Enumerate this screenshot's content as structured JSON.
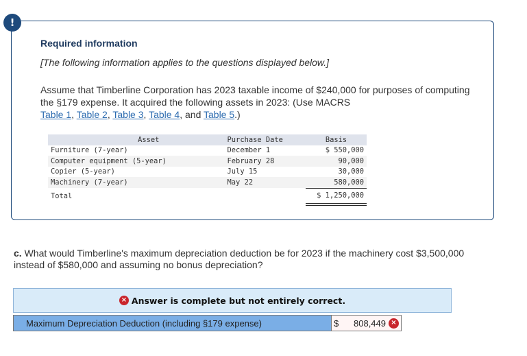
{
  "info": {
    "badge_icon": "!",
    "title": "Required information",
    "note": "[The following information applies to the questions displayed below.]",
    "assume_text": "Assume that Timberline Corporation has 2023 taxable income of $240,000 for purposes of computing the §179 expense. It acquired the following assets in 2023: (Use MACRS ",
    "links": [
      "Table 1",
      "Table 2",
      "Table 3",
      "Table 4",
      "Table 5"
    ],
    "sep_comma": ", ",
    "sep_and": ", and ",
    "assume_tail": ".)"
  },
  "asset_table": {
    "headers": [
      "Asset",
      "Purchase Date",
      "Basis"
    ],
    "rows": [
      {
        "asset": "Furniture (7-year)",
        "date": "December 1",
        "basis": "$ 550,000"
      },
      {
        "asset": "Computer equipment (5-year)",
        "date": "February 28",
        "basis": "90,000"
      },
      {
        "asset": "Copier (5-year)",
        "date": "July 15",
        "basis": "30,000"
      },
      {
        "asset": "Machinery (7-year)",
        "date": "May 22",
        "basis": "580,000"
      }
    ],
    "total": {
      "label": "Total",
      "basis": "$ 1,250,000"
    }
  },
  "question": {
    "prefix": "c.",
    "text": " What would Timberline's maximum depreciation deduction be for 2023 if the machinery cost $3,500,000 instead of $580,000 and assuming no bonus depreciation?"
  },
  "feedback": {
    "icon": "×",
    "message": "Answer is complete but not entirely correct."
  },
  "answer": {
    "label": "Maximum Depreciation Deduction (including §179 expense)",
    "currency": "$",
    "value": "808,449",
    "status": "incorrect",
    "status_icon": "×"
  },
  "colors": {
    "primary_navy": "#1e4a7c",
    "link": "#2d6cb0",
    "feedback_bg": "#d9ebf9",
    "label_bg": "#7aaee6",
    "error_red": "#c9252c"
  }
}
